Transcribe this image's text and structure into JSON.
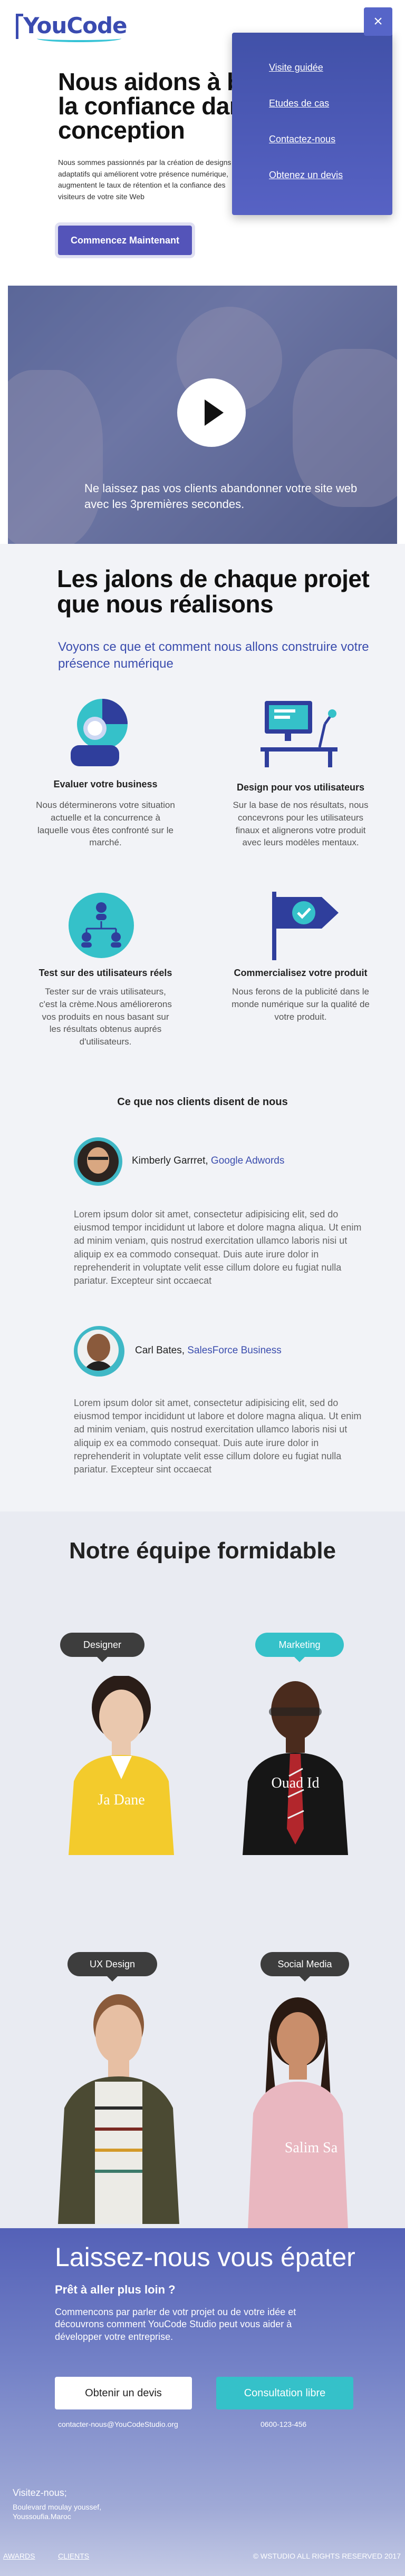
{
  "brand": {
    "logo_text": "YouCode"
  },
  "hero": {
    "title_line1": "Nous aidons à b",
    "title_line2": "la confiance dan",
    "title_line3": "conception",
    "text": "Nous sommes passionnés par la création de designs adaptatifs qui améliorent votre présence numérique, augmentent le taux de rétention et la confiance des visiteurs de votre site Web",
    "cta_label": "Commencez Maintenant"
  },
  "menu": {
    "close_label": "×",
    "items": [
      "Visite guidée",
      "Etudes de cas",
      "Contactez-nous",
      "Obtenez un devis"
    ]
  },
  "video": {
    "caption": "Ne laissez pas vos clients abandonner votre site web avec les 3premières secondes."
  },
  "milestones": {
    "title_line1": "Les jalons de chaque projet",
    "title_line2": "que nous réalisons",
    "subtitle": "Voyons ce que et comment nous allons construire votre présence numérique",
    "items": [
      {
        "title": "Evaluer votre business",
        "text": "Nous déterminerons votre situation actuelle et la concurrence à laquelle vous êtes confronté sur le marché.",
        "icon": "target-user-icon"
      },
      {
        "title": "Design pour  vos utilisateurs",
        "text": "Sur la base de nos résultats, nous concevrons pour les utilisateurs finaux et alignerons votre produit avec leurs modèles mentaux.",
        "icon": "desk-monitor-icon"
      },
      {
        "title": "Test sur des utilisateurs réels",
        "text": "Tester sur de vrais utilisateurs, c'est la crème.Nous améliorerons vos produits en nous basant sur les résultats obtenus auprés d'utilisateurs.",
        "icon": "user-network-icon"
      },
      {
        "title": "Commercialisez votre produit",
        "text": "Nous ferons de la publicité dans le monde numérique sur la qualité de votre produit.",
        "icon": "check-flag-icon"
      }
    ]
  },
  "testimonials": {
    "heading": "Ce que nos clients disent de nous",
    "items": [
      {
        "name": "Kimberly Garrret",
        "separator": ", ",
        "company": "Google Adwords",
        "text": "Lorem ipsum dolor sit amet, consectetur adipisicing elit, sed do eiusmod tempor incididunt ut labore et dolore magna aliqua. Ut enim ad minim veniam, quis nostrud exercitation ullamco laboris nisi ut aliquip ex ea commodo consequat. Duis aute irure dolor in reprehenderit in voluptate velit esse cillum dolore eu fugiat nulla pariatur. Excepteur sint occaecat"
      },
      {
        "name": "Carl Bates",
        "separator": ", ",
        "company": "SalesForce Business",
        "text": "Lorem ipsum dolor sit amet, consectetur adipisicing elit, sed do eiusmod tempor incididunt ut labore et dolore magna aliqua. Ut enim ad minim veniam, quis nostrud exercitation ullamco laboris nisi ut aliquip ex ea commodo consequat. Duis aute irure dolor in reprehenderit in voluptate velit esse cillum dolore eu fugiat nulla pariatur. Excepteur sint occaecat"
      }
    ]
  },
  "team": {
    "title": "Notre équipe formidable",
    "members": [
      {
        "role": "Designer",
        "name": "Ja Dane",
        "style": "dark"
      },
      {
        "role": "Marketing",
        "name": "Ouad Id",
        "style": "teal"
      },
      {
        "role": "UX Design",
        "name": "",
        "style": "dark"
      },
      {
        "role": "Social Media",
        "name": "Salim Sa",
        "style": "dark"
      }
    ]
  },
  "cta": {
    "title": "Laissez-nous vous épater",
    "question": "Prêt à aller plus loin ?",
    "text": "Commencons par parler de votr projet ou de votre idée et découvrons comment YouCode Studio peut vous aider à développer votre entreprise.",
    "quote_button": "Obtenir un devis",
    "consult_button": "Consultation libre",
    "email": "contacter-nous@YouCodeStudio.org",
    "phone": "0600-123-456"
  },
  "footer": {
    "visit_label": "Visitez-nous;",
    "address_line1": "Boulevard moulay youssef,",
    "address_line2": "Youssoufia.Maroc",
    "links": [
      "AWARDS",
      "CLIENTS"
    ],
    "copyright": "© WSTUDIO ALL RIGHTS RESERVED 2017"
  },
  "colors": {
    "primary": "#3b4dae",
    "accent": "#35c1c9",
    "button": "#5454b9"
  }
}
